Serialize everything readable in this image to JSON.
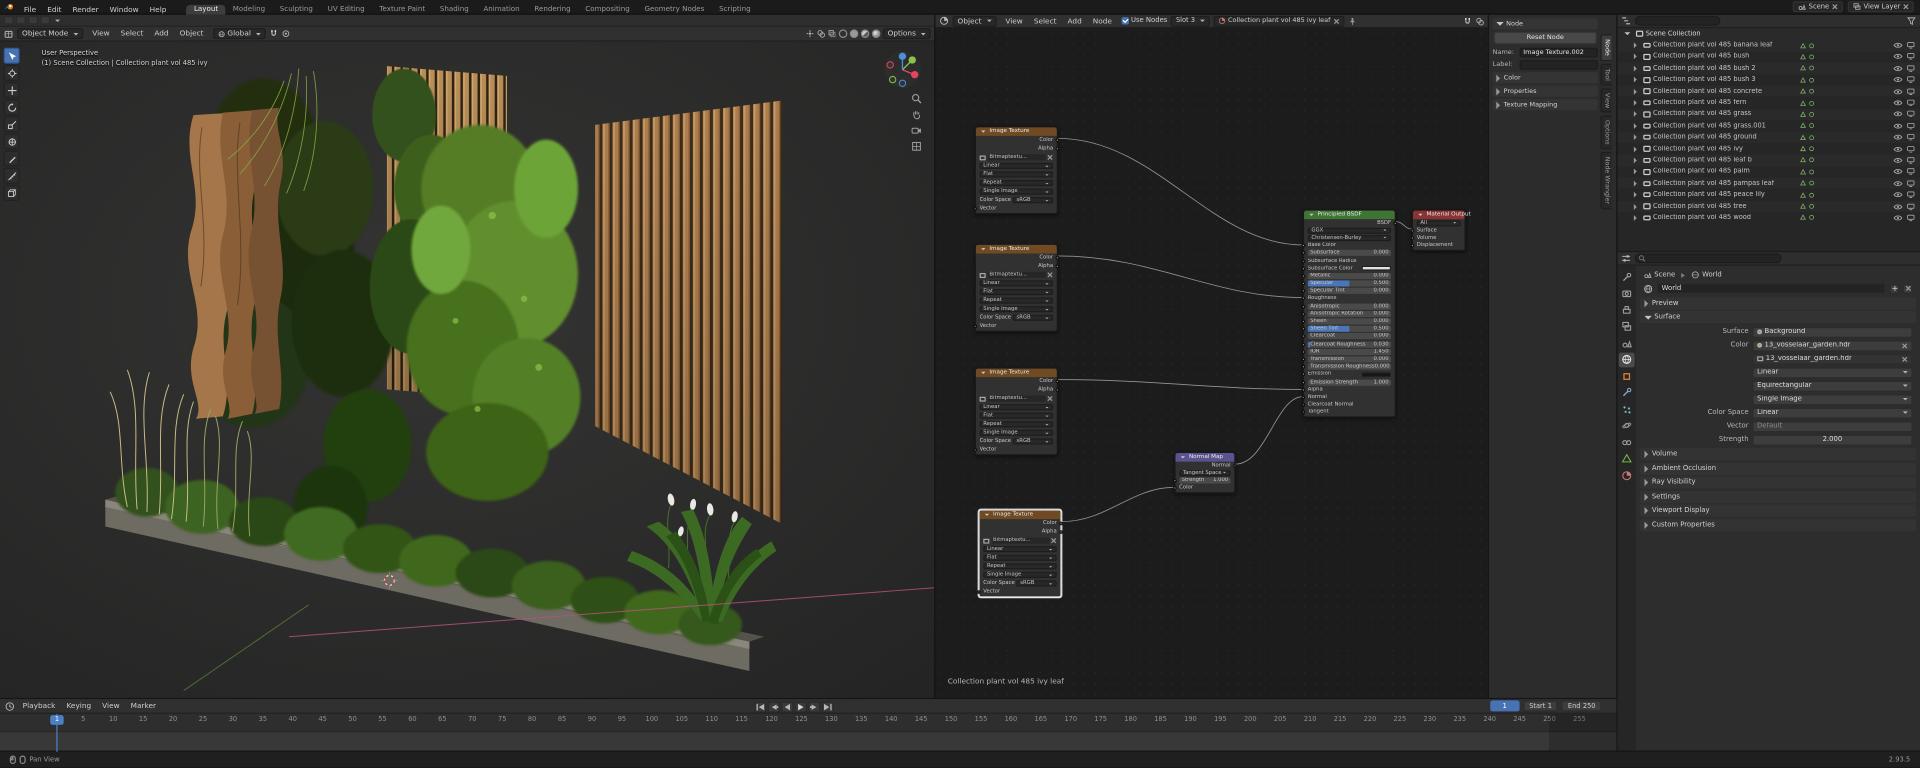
{
  "topbar": {
    "menus": [
      "File",
      "Edit",
      "Render",
      "Window",
      "Help"
    ],
    "workspaces": [
      "Layout",
      "Modeling",
      "Sculpting",
      "UV Editing",
      "Texture Paint",
      "Shading",
      "Animation",
      "Rendering",
      "Compositing",
      "Geometry Nodes",
      "Scripting"
    ],
    "active_workspace": "Layout",
    "scene_label": "Scene",
    "view_layer_label": "View Layer"
  },
  "viewport": {
    "mode": "Object Mode",
    "menus": [
      "View",
      "Select",
      "Add",
      "Object"
    ],
    "orientation": "Global",
    "options_label": "Options",
    "overlay_line1": "User Perspective",
    "overlay_line2": "(1) Scene Collection | Collection plant vol 485 ivy"
  },
  "shader": {
    "type_label": "Object",
    "menus": [
      "View",
      "Select",
      "Add",
      "Node"
    ],
    "use_nodes_label": "Use Nodes",
    "slot_label": "Slot 3",
    "material_name": "Collection plant vol 485 ivy leaf",
    "status_text": "Collection plant vol 485 ivy leaf",
    "tex_node": {
      "title": "Image Texture",
      "out_color": "Color",
      "out_alpha": "Alpha",
      "image_name": "Bitmaptextu...",
      "interpolation": "Linear",
      "projection": "Flat",
      "extension": "Repeat",
      "source": "Single Image",
      "color_space_label": "Color Space",
      "color_space_value": "sRGB",
      "vector_label": "Vector"
    },
    "normal_node": {
      "title": "Normal Map",
      "out": "Normal",
      "space": "Tangent Space",
      "strength_label": "Strength",
      "strength_value": "1.000",
      "color_label": "Color"
    },
    "bsdf": {
      "title": "Principled BSDF",
      "out": "BSDF",
      "distribution": "GGX",
      "subsurface_method": "Christensen-Burley",
      "rows": [
        {
          "label": "Base Color",
          "kind": "plain",
          "socket": "yellow"
        },
        {
          "label": "Subsurface",
          "value": "0.000",
          "kind": "slider",
          "socket": "gray",
          "fill": 0
        },
        {
          "label": "Subsurface Radius",
          "kind": "plain",
          "socket": "blue"
        },
        {
          "label": "Subsurface Color",
          "kind": "color",
          "socket": "yellow",
          "swatch": "#e2e2e2"
        },
        {
          "label": "Metallic",
          "value": "0.000",
          "kind": "slider",
          "socket": "gray",
          "fill": 0
        },
        {
          "label": "Specular",
          "value": "0.500",
          "kind": "slider",
          "socket": "gray",
          "fill": 50
        },
        {
          "label": "Specular Tint",
          "value": "0.000",
          "kind": "slider",
          "socket": "gray",
          "fill": 0
        },
        {
          "label": "Roughness",
          "kind": "plain",
          "socket": "gray"
        },
        {
          "label": "Anisotropic",
          "value": "0.000",
          "kind": "slider",
          "socket": "gray",
          "fill": 0
        },
        {
          "label": "Anisotropic Rotation",
          "value": "0.000",
          "kind": "slider",
          "socket": "gray",
          "fill": 0
        },
        {
          "label": "Sheen",
          "value": "0.000",
          "kind": "slider",
          "socket": "gray",
          "fill": 0
        },
        {
          "label": "Sheen Tint",
          "value": "0.500",
          "kind": "slider",
          "socket": "gray",
          "fill": 50
        },
        {
          "label": "Clearcoat",
          "value": "0.000",
          "kind": "slider",
          "socket": "gray",
          "fill": 0
        },
        {
          "label": "Clearcoat Roughness",
          "value": "0.030",
          "kind": "slider",
          "socket": "gray",
          "fill": 3
        },
        {
          "label": "IOR",
          "value": "1.450",
          "kind": "value",
          "socket": "gray"
        },
        {
          "label": "Transmission",
          "value": "0.000",
          "kind": "slider",
          "socket": "gray",
          "fill": 0
        },
        {
          "label": "Transmission Roughness",
          "value": "0.000",
          "kind": "slider",
          "socket": "gray",
          "fill": 0
        },
        {
          "label": "Emission",
          "kind": "color",
          "socket": "yellow",
          "swatch": "#151515"
        },
        {
          "label": "Emission Strength",
          "value": "1.000",
          "kind": "value",
          "socket": "gray"
        },
        {
          "label": "Alpha",
          "kind": "plain",
          "socket": "gray"
        },
        {
          "label": "Normal",
          "kind": "plain",
          "socket": "blue"
        },
        {
          "label": "Clearcoat Normal",
          "kind": "plain",
          "socket": "blue"
        },
        {
          "label": "Tangent",
          "kind": "plain",
          "socket": "blue"
        }
      ]
    },
    "output_node": {
      "title": "Material Output",
      "target": "All",
      "inputs": [
        "Surface",
        "Volume",
        "Displacement"
      ]
    }
  },
  "npanel": {
    "section_node": "Node",
    "reset_button": "Reset Node",
    "name_label": "Name:",
    "name_value": "Image Texture.002",
    "label_label": "Label:",
    "label_value": "",
    "sections": [
      "Color",
      "Properties",
      "Texture Mapping"
    ],
    "tabs": [
      "Node",
      "Tool",
      "View",
      "Options",
      "Node Wrangler"
    ],
    "active_tab": "Node"
  },
  "outliner": {
    "root": "Scene Collection",
    "items": [
      "Collection plant vol 485 banana leaf",
      "Collection plant vol 485 bush",
      "Collection plant vol 485 bush 2",
      "Collection plant vol 485 bush 3",
      "Collection plant vol 485 concrete",
      "Collection plant vol 485 fern",
      "Collection plant vol 485 grass",
      "Collection plant vol 485 grass.001",
      "Collection plant vol 485 ground",
      "Collection plant vol 485 ivy",
      "Collection plant vol 485 leaf b",
      "Collection plant vol 485 palm",
      "Collection plant vol 485 pampas leaf",
      "Collection plant vol 485 peace lily",
      "Collection plant vol 485 tree",
      "Collection plant vol 485 wood"
    ]
  },
  "properties": {
    "breadcrumb_scene": "Scene",
    "breadcrumb_world": "World",
    "world_name": "World",
    "preview_section": "Preview",
    "open_section": "Surface",
    "surface_label": "Surface",
    "surface_value": "Background",
    "color_label": "Color",
    "color_value": "13_vosselaar_garden.hdr",
    "image_name": "13_vosselaar_garden.hdr",
    "interpolation": "Linear",
    "projection": "Equirectangular",
    "source": "Single Image",
    "color_space_label": "Color Space",
    "color_space_value": "Linear",
    "vector_label": "Vector",
    "vector_value": "Default",
    "strength_label": "Strength",
    "strength_value": "2.000",
    "collapsed_sections": [
      "Volume",
      "Ambient Occlusion",
      "Ray Visibility",
      "Settings",
      "Viewport Display",
      "Custom Properties"
    ]
  },
  "timeline": {
    "menus": [
      "Playback",
      "Keying",
      "View",
      "Marker"
    ],
    "current_frame": "1",
    "start_label": "Start",
    "start_value": "1",
    "end_label": "End",
    "end_value": "250",
    "ticks": [
      5,
      10,
      15,
      20,
      25,
      30,
      35,
      40,
      45,
      50,
      55,
      60,
      65,
      70,
      75,
      80,
      85,
      90,
      95,
      100,
      105,
      110,
      115,
      120,
      125,
      130,
      135,
      140,
      145,
      150,
      155,
      160,
      165,
      170,
      175,
      180,
      185,
      190,
      195,
      200,
      205,
      210,
      215,
      220,
      225,
      230,
      235,
      240,
      245,
      250,
      255
    ]
  },
  "statusbar": {
    "left_hint": "Pan View",
    "version": "2.93.5"
  }
}
